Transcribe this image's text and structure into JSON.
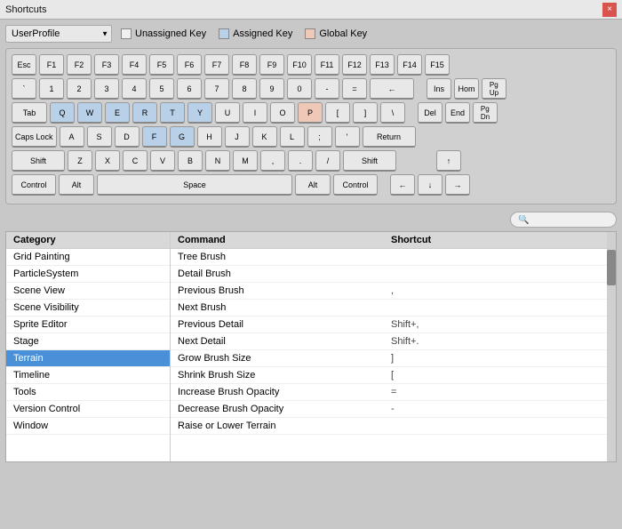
{
  "titleBar": {
    "title": "Shortcuts",
    "closeLabel": "×"
  },
  "profile": {
    "value": "UserProfile",
    "options": [
      "UserProfile"
    ]
  },
  "legend": {
    "unassigned": "Unassigned Key",
    "assigned": "Assigned Key",
    "global": "Global Key"
  },
  "keyboard": {
    "rows": [
      [
        "Esc",
        "F1",
        "F2",
        "F3",
        "F4",
        "F5",
        "F6",
        "F7",
        "F8",
        "F9",
        "F10",
        "F11",
        "F12",
        "F13",
        "F14",
        "F15"
      ],
      [
        "`",
        "1",
        "2",
        "3",
        "4",
        "5",
        "6",
        "7",
        "8",
        "9",
        "0",
        "-",
        "=",
        "←"
      ],
      [
        "Tab",
        "Q",
        "W",
        "E",
        "R",
        "T",
        "Y",
        "U",
        "I",
        "O",
        "P",
        "[",
        "]",
        "\\"
      ],
      [
        "Caps Lock",
        "A",
        "S",
        "D",
        "F",
        "G",
        "H",
        "J",
        "K",
        "L",
        ";",
        "'",
        "Return"
      ],
      [
        "Shift",
        "Z",
        "X",
        "C",
        "V",
        "B",
        "N",
        "M",
        ",",
        ".",
        "/",
        "Shift"
      ],
      [
        "Control",
        "Alt",
        "Space",
        "Alt",
        "Control"
      ]
    ],
    "assignedKeys": [
      "Q",
      "W",
      "E",
      "R",
      "T",
      "Y",
      "P",
      "F",
      "G"
    ],
    "globalKeys": []
  },
  "search": {
    "placeholder": "🔍",
    "value": ""
  },
  "categories": {
    "header": "Category",
    "items": [
      "Grid Painting",
      "ParticleSystem",
      "Scene View",
      "Scene Visibility",
      "Sprite Editor",
      "Stage",
      "Terrain",
      "Timeline",
      "Tools",
      "Version Control",
      "Window"
    ],
    "selected": "Terrain"
  },
  "commands": {
    "commandHeader": "Command",
    "shortcutHeader": "Shortcut",
    "items": [
      {
        "name": "Tree Brush",
        "shortcut": ""
      },
      {
        "name": "Detail Brush",
        "shortcut": ""
      },
      {
        "name": "Previous Brush",
        "shortcut": ","
      },
      {
        "name": "Next Brush",
        "shortcut": ""
      },
      {
        "name": "Previous Detail",
        "shortcut": "Shift+,"
      },
      {
        "name": "Next Detail",
        "shortcut": "Shift+."
      },
      {
        "name": "Grow Brush Size",
        "shortcut": "]"
      },
      {
        "name": "Shrink Brush Size",
        "shortcut": "["
      },
      {
        "name": "Increase Brush Opacity",
        "shortcut": "="
      },
      {
        "name": "Decrease Brush Opacity",
        "shortcut": "-"
      },
      {
        "name": "Raise or Lower Terrain",
        "shortcut": ""
      }
    ]
  }
}
